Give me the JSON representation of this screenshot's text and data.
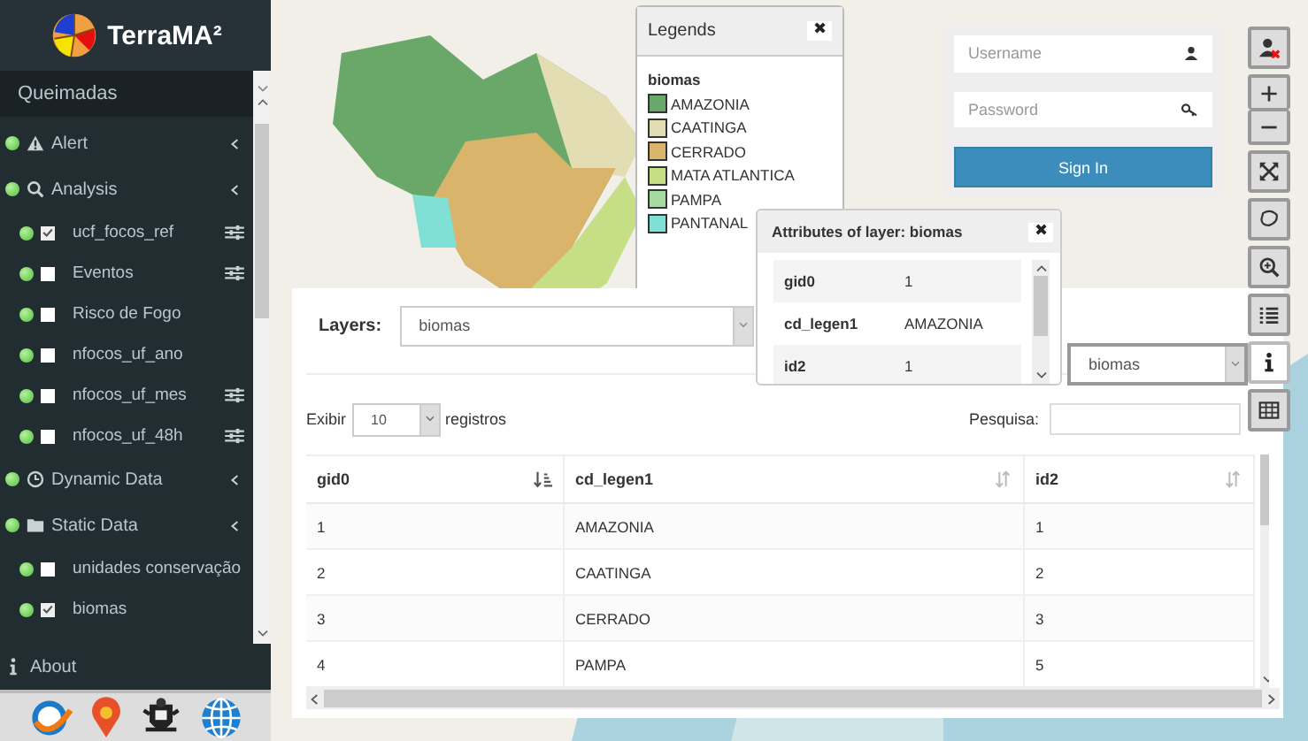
{
  "app": {
    "title": "TerraMA²",
    "project": "Queimadas"
  },
  "sidebar": {
    "groups": [
      {
        "label": "Alert",
        "kind": "alert"
      },
      {
        "label": "Analysis",
        "kind": "analysis",
        "children": [
          {
            "label": "ucf_focos_ref",
            "checked": true,
            "settings": true
          },
          {
            "label": "Eventos",
            "checked": false,
            "settings": true
          },
          {
            "label": "Risco de Fogo",
            "checked": false,
            "settings": false
          },
          {
            "label": "nfocos_uf_ano",
            "checked": false,
            "settings": false
          },
          {
            "label": "nfocos_uf_mes",
            "checked": false,
            "settings": true
          },
          {
            "label": "nfocos_uf_48h",
            "checked": false,
            "settings": true
          }
        ]
      },
      {
        "label": "Dynamic Data",
        "kind": "dynamic"
      },
      {
        "label": "Static Data",
        "kind": "static",
        "children": [
          {
            "label": "unidades conservação",
            "checked": false,
            "settings": false
          },
          {
            "label": "biomas",
            "checked": true,
            "settings": false
          }
        ]
      }
    ],
    "about": "About"
  },
  "legends": {
    "title": "Legends",
    "close": "✖",
    "layer": "biomas",
    "entries": [
      {
        "label": "AMAZONIA",
        "color": "#6aa86a"
      },
      {
        "label": "CAATINGA",
        "color": "#e2ddb2"
      },
      {
        "label": "CERRADO",
        "color": "#d9b46a"
      },
      {
        "label": "MATA ATLANTICA",
        "color": "#c6df86"
      },
      {
        "label": "PAMPA",
        "color": "#a6dba0"
      },
      {
        "label": "PANTANAL",
        "color": "#80e0d6"
      }
    ]
  },
  "login": {
    "username_placeholder": "Username",
    "password_placeholder": "Password",
    "button": "Sign In"
  },
  "tools": [
    {
      "kind": "user",
      "selected": false
    },
    {
      "kind": "zoom-in",
      "selected": false
    },
    {
      "kind": "zoom-out",
      "selected": false
    },
    {
      "kind": "extent",
      "selected": false
    },
    {
      "kind": "lasso",
      "selected": false
    },
    {
      "kind": "zoom-box",
      "selected": false
    },
    {
      "kind": "layers",
      "selected": false
    },
    {
      "kind": "info",
      "selected": true
    },
    {
      "kind": "table",
      "selected": false
    }
  ],
  "attributes": {
    "title": "Attributes of layer: biomas",
    "close": "✖",
    "rows": [
      {
        "key": "gid0",
        "value": "1"
      },
      {
        "key": "cd_legen1",
        "value": "AMAZONIA"
      },
      {
        "key": "id2",
        "value": "1"
      }
    ]
  },
  "table_panel": {
    "layers_label": "Layers:",
    "layer": "biomas",
    "info_layer": "biomas",
    "show_label": "Exibir",
    "page_size": "10",
    "records_label": "registros",
    "search_label": "Pesquisa:",
    "columns": [
      {
        "label": "gid0",
        "sorted": true
      },
      {
        "label": "cd_legen1",
        "sorted": false
      },
      {
        "label": "id2",
        "sorted": false
      }
    ],
    "rows": [
      [
        "1",
        "AMAZONIA",
        "1"
      ],
      [
        "2",
        "CAATINGA",
        "2"
      ],
      [
        "3",
        "CERRADO",
        "3"
      ],
      [
        "4",
        "PAMPA",
        "5"
      ]
    ]
  }
}
